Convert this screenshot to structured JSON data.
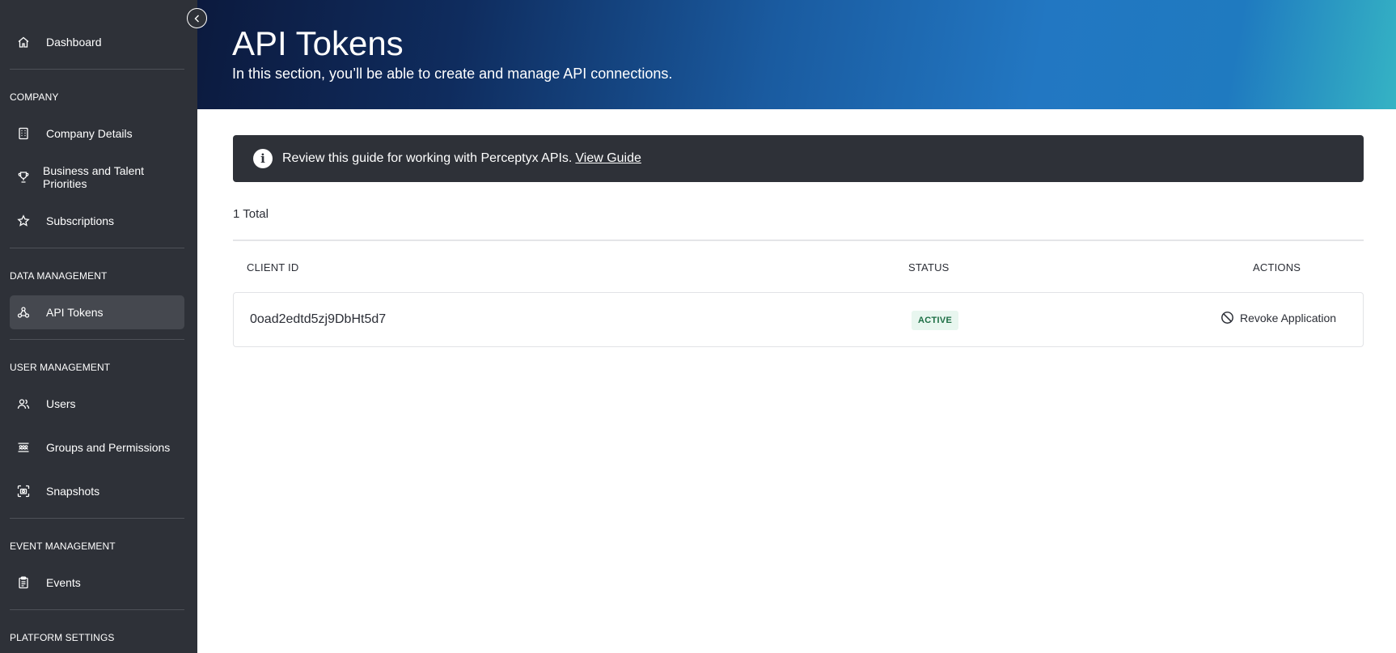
{
  "sidebar": {
    "dashboard": "Dashboard",
    "sections": {
      "company": "COMPANY",
      "data_management": "DATA MANAGEMENT",
      "user_management": "USER MANAGEMENT",
      "event_management": "EVENT MANAGEMENT",
      "platform_settings": "PLATFORM SETTINGS"
    },
    "items": {
      "company_details": "Company Details",
      "business_talent": "Business and Talent Priorities",
      "subscriptions": "Subscriptions",
      "api_tokens": "API Tokens",
      "users": "Users",
      "groups_permissions": "Groups and Permissions",
      "snapshots": "Snapshots",
      "events": "Events"
    },
    "active_item": "API Tokens"
  },
  "header": {
    "title": "API Tokens",
    "subtitle": "In this section, you’ll be able to create and manage API connections."
  },
  "info_bar": {
    "text": "Review this guide for working with Perceptyx APIs.",
    "link": "View Guide",
    "icon": "info-icon"
  },
  "table": {
    "total": "1 Total",
    "columns": {
      "client_id": "CLIENT ID",
      "status": "STATUS",
      "actions": "ACTIONS"
    },
    "rows": [
      {
        "client_id": "0oad2edtd5zj9DbHt5d7",
        "status": "ACTIVE",
        "action": "Revoke Application"
      }
    ]
  },
  "colors": {
    "sidebar_bg": "#2e3138",
    "active_item_bg": "#45484f",
    "status_active_bg": "#e8f6ef",
    "status_active_text": "#1c6e44"
  }
}
